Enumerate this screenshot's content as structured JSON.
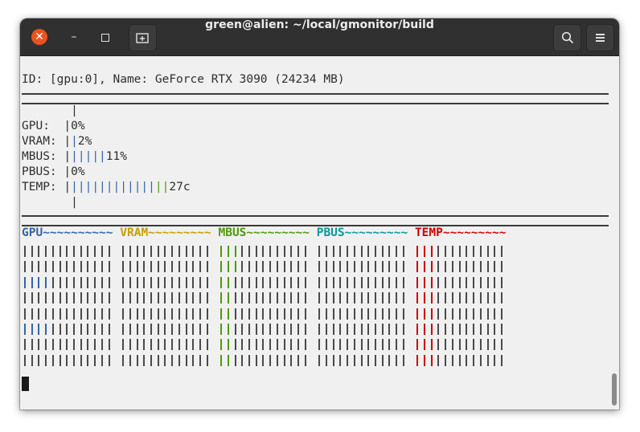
{
  "window": {
    "title": "green@alien: ~/local/gmonitor/build",
    "close_glyph": "✕",
    "minimize_glyph": "–"
  },
  "terminal": {
    "header_line": "ID: [gpu:0], Name: GeForce RTX 3090 (24234 MB)",
    "bars": [
      {
        "label": "GPU:",
        "prefix": "  |",
        "ticks": "",
        "value_text": "0%",
        "level": 0
      },
      {
        "label": "VRAM:",
        "prefix": " |",
        "ticks": "|",
        "value_text": "2%",
        "level": 0.02
      },
      {
        "label": "MBUS:",
        "prefix": " |",
        "ticks": "|||||",
        "value_text": "11%",
        "level": 0.11
      },
      {
        "label": "PBUS:",
        "prefix": " |",
        "ticks": "",
        "value_text": "0%",
        "level": 0
      },
      {
        "label": "TEMP:",
        "prefix": " |",
        "ticks": "||||||||||||",
        "ticks_green": "||",
        "value_text": "27c",
        "level": 0.27
      }
    ],
    "graph_headers": [
      {
        "name": "GPU",
        "tilde": "~~~~~~~~~~",
        "color": "#3465a4"
      },
      {
        "name": "VRAM",
        "tilde": "~~~~~~~~~",
        "color": "#c4a000"
      },
      {
        "name": "MBUS",
        "tilde": "~~~~~~~~~",
        "color": "#4e9a06"
      },
      {
        "name": "PBUS",
        "tilde": "~~~~~~~~~",
        "color": "#06989a"
      },
      {
        "name": "TEMP",
        "tilde": "~~~~~~~~~",
        "color": "#cc0000"
      }
    ]
  },
  "icons": {
    "close": "close-icon",
    "minimize": "minimize-icon",
    "maximize": "maximize-icon",
    "new_tab": "new-tab-icon",
    "search": "search-icon",
    "menu": "hamburger-menu-icon"
  }
}
